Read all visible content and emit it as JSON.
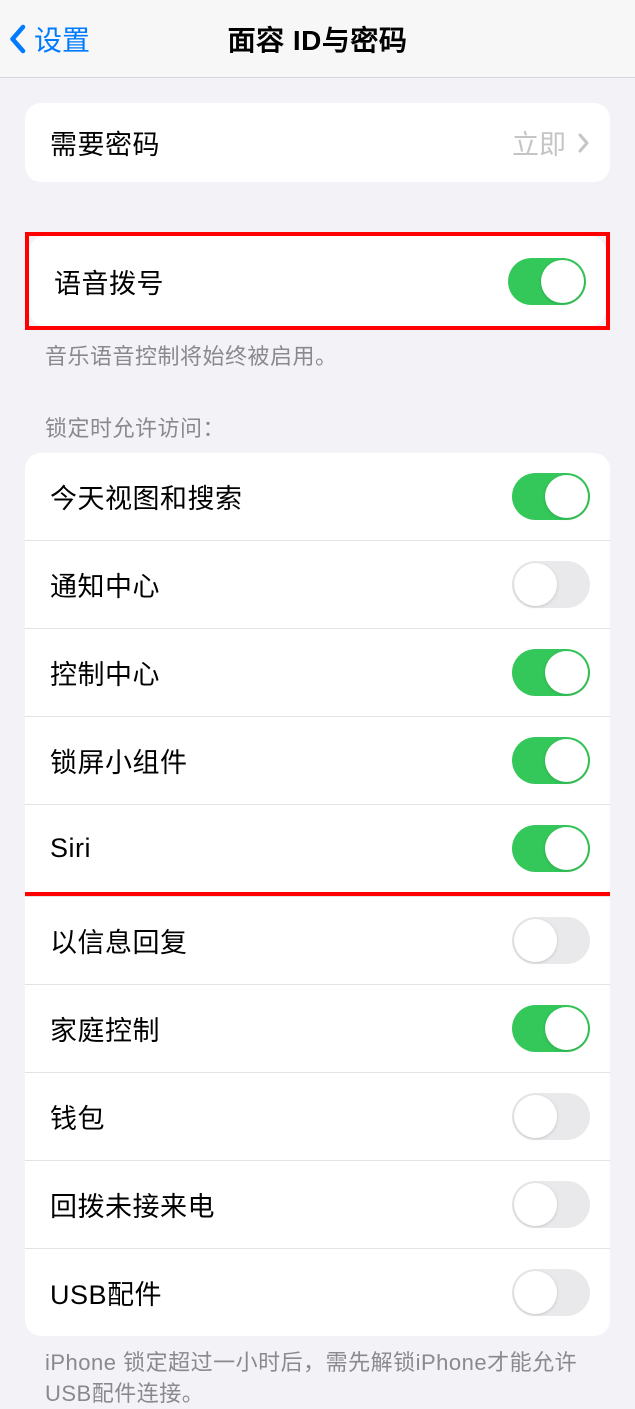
{
  "header": {
    "back_label": "设置",
    "title": "面容 ID与密码"
  },
  "passcode_group": {
    "require_label": "需要密码",
    "require_value": "立即"
  },
  "voice_group": {
    "voice_dial_label": "语音拨号",
    "voice_dial_on": true,
    "footer": "音乐语音控制将始终被启用。"
  },
  "lock_section_header": "锁定时允许访问：",
  "lock_items": [
    {
      "label": "今天视图和搜索",
      "on": true,
      "highlight": false
    },
    {
      "label": "通知中心",
      "on": false,
      "highlight": false
    },
    {
      "label": "控制中心",
      "on": true,
      "highlight": false
    },
    {
      "label": "锁屏小组件",
      "on": true,
      "highlight": false
    },
    {
      "label": "Siri",
      "on": true,
      "highlight": true
    },
    {
      "label": "以信息回复",
      "on": false,
      "highlight": false
    },
    {
      "label": "家庭控制",
      "on": true,
      "highlight": false
    },
    {
      "label": "钱包",
      "on": false,
      "highlight": false
    },
    {
      "label": "回拨未接来电",
      "on": false,
      "highlight": false
    },
    {
      "label": "USB配件",
      "on": false,
      "highlight": false
    }
  ],
  "lock_footer": "iPhone 锁定超过一小时后，需先解锁iPhone才能允许USB配件连接。"
}
